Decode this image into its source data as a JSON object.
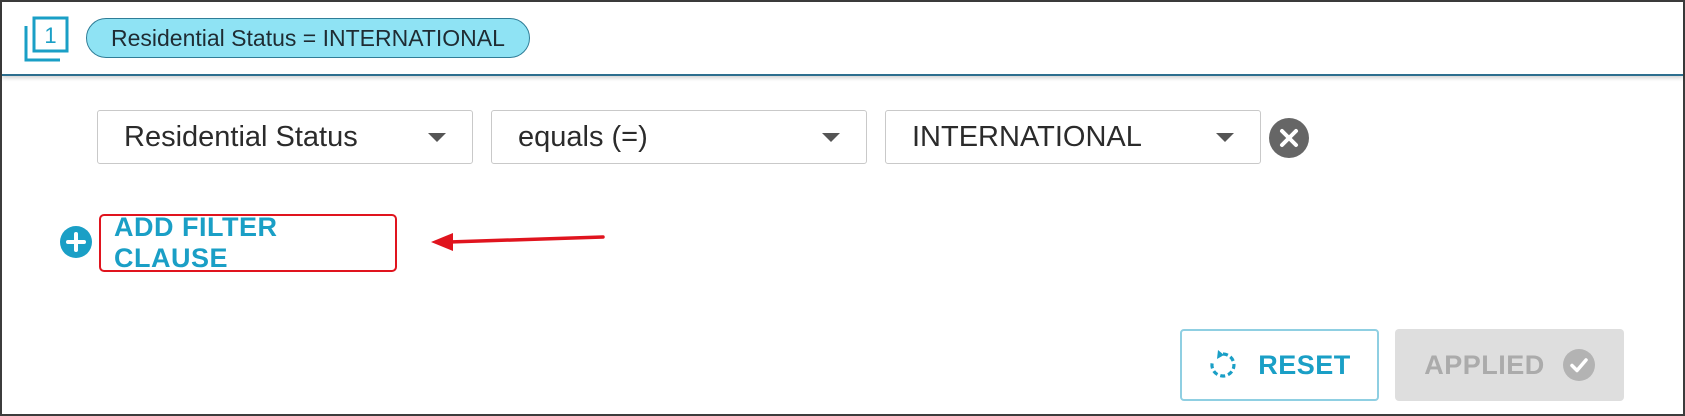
{
  "header": {
    "filter_count_icon": "filter-count-1-icon",
    "filter_count": "1",
    "chip_label": "Residential Status = INTERNATIONAL"
  },
  "clause": {
    "field": "Residential Status",
    "operator": "equals (=)",
    "value": "INTERNATIONAL",
    "remove_icon": "close-circle-icon"
  },
  "actions": {
    "add_icon": "plus-circle-icon",
    "add_label": "ADD FILTER CLAUSE",
    "reset_icon": "refresh-icon",
    "reset_label": "RESET",
    "applied_label": "APPLIED",
    "applied_icon": "check-circle-icon"
  },
  "colors": {
    "accent": "#1a9fc6",
    "chip_bg": "#8fe3f4",
    "highlight_red": "#e0141e",
    "disabled_bg": "#dedede",
    "disabled_text": "#ababab"
  }
}
